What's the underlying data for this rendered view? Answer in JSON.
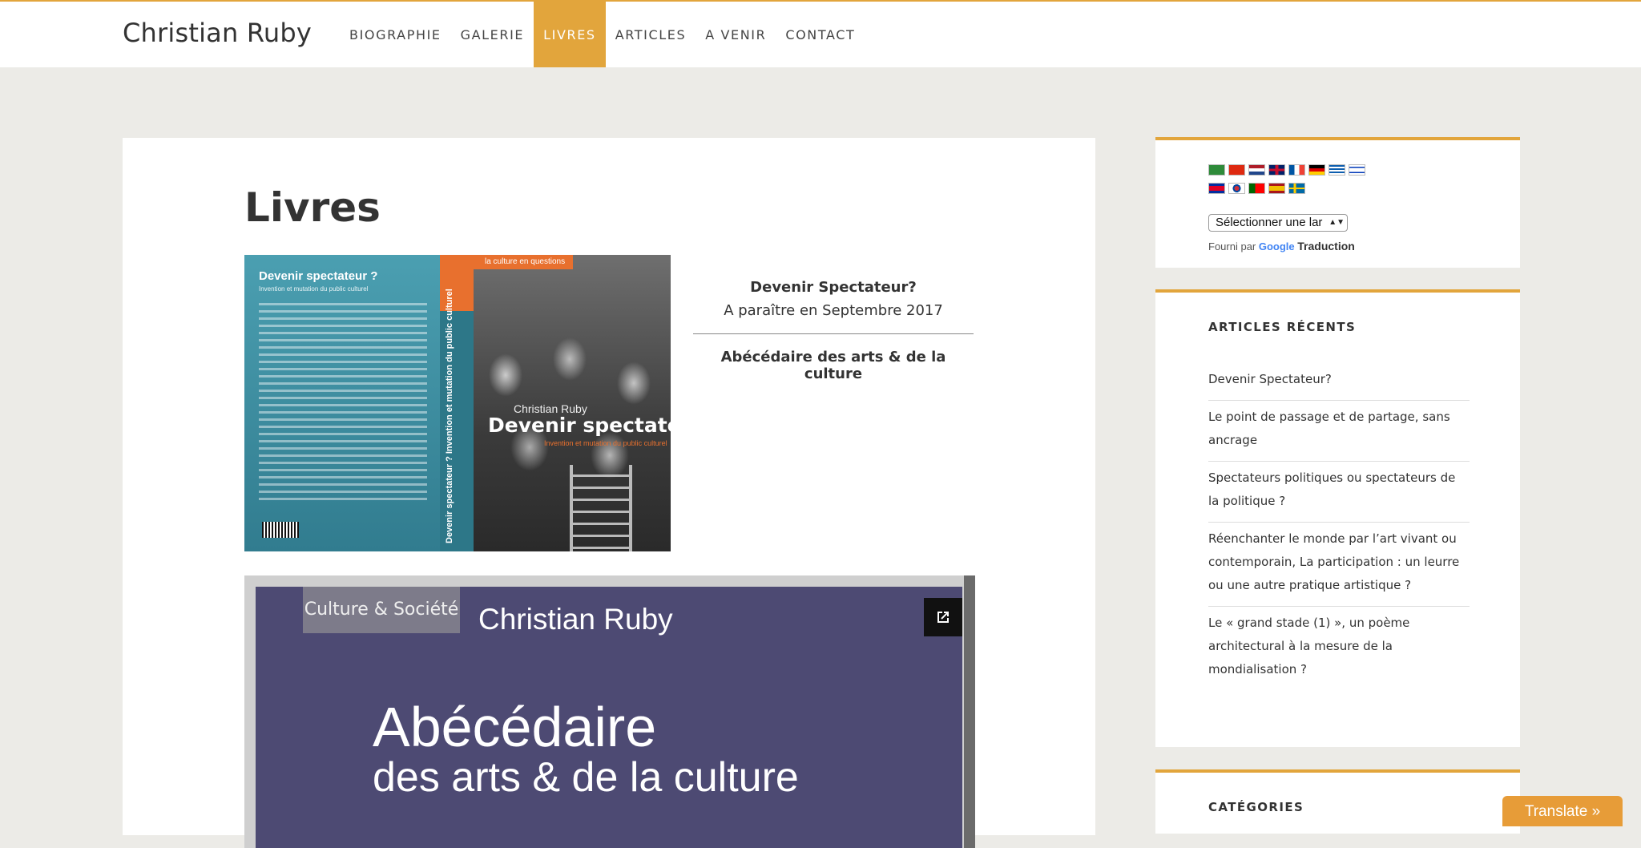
{
  "site": {
    "title": "Christian Ruby"
  },
  "nav": {
    "items": [
      {
        "label": "BIOGRAPHIE",
        "active": false
      },
      {
        "label": "GALERIE",
        "active": false
      },
      {
        "label": "LIVRES",
        "active": true
      },
      {
        "label": "ARTICLES",
        "active": false
      },
      {
        "label": "A VENIR",
        "active": false
      },
      {
        "label": "CONTACT",
        "active": false
      }
    ]
  },
  "page": {
    "title": "Livres"
  },
  "book1": {
    "cover": {
      "back_title": "Devenir spectateur ?",
      "back_subtitle": "Invention et mutation du public culturel",
      "spine_text": "Devenir spectateur ? Invention et mutation du public culturel",
      "series": "la culture en questions",
      "author": "Christian Ruby",
      "title": "Devenir spectateur ?",
      "subtitle": "Invention et mutation du public culturel"
    },
    "info_title": "Devenir Spectateur?",
    "info_date": "A paraître en Septembre 2017"
  },
  "book2": {
    "info_title": "Abécédaire des arts & de la culture",
    "viewer": {
      "collection": "Culture & Société",
      "author": "Christian Ruby",
      "title_line1": "Abécédaire",
      "title_line2": "des arts & de la culture"
    }
  },
  "sidebar": {
    "translate": {
      "select_value": "Sélectionner une lar",
      "powered_by": "Fourni par",
      "google": "Google",
      "translation": "Traduction"
    },
    "recent": {
      "title": "ARTICLES RÉCENTS",
      "items": [
        "Devenir Spectateur?",
        "Le point de passage et de partage, sans ancrage",
        "Spectateurs politiques ou spectateurs de la politique ?",
        "Réenchanter le monde par l’art vivant ou contemporain, La participation : un leurre ou une autre pratique artistique ?",
        "Le « grand stade (1) », un poème architectural à la mesure de la mondialisation ?"
      ]
    },
    "categories": {
      "title": "CATÉGORIES"
    }
  },
  "translate_button": {
    "label": "Translate »"
  },
  "colors": {
    "accent": "#e2a53c",
    "background": "#ecebe7"
  }
}
